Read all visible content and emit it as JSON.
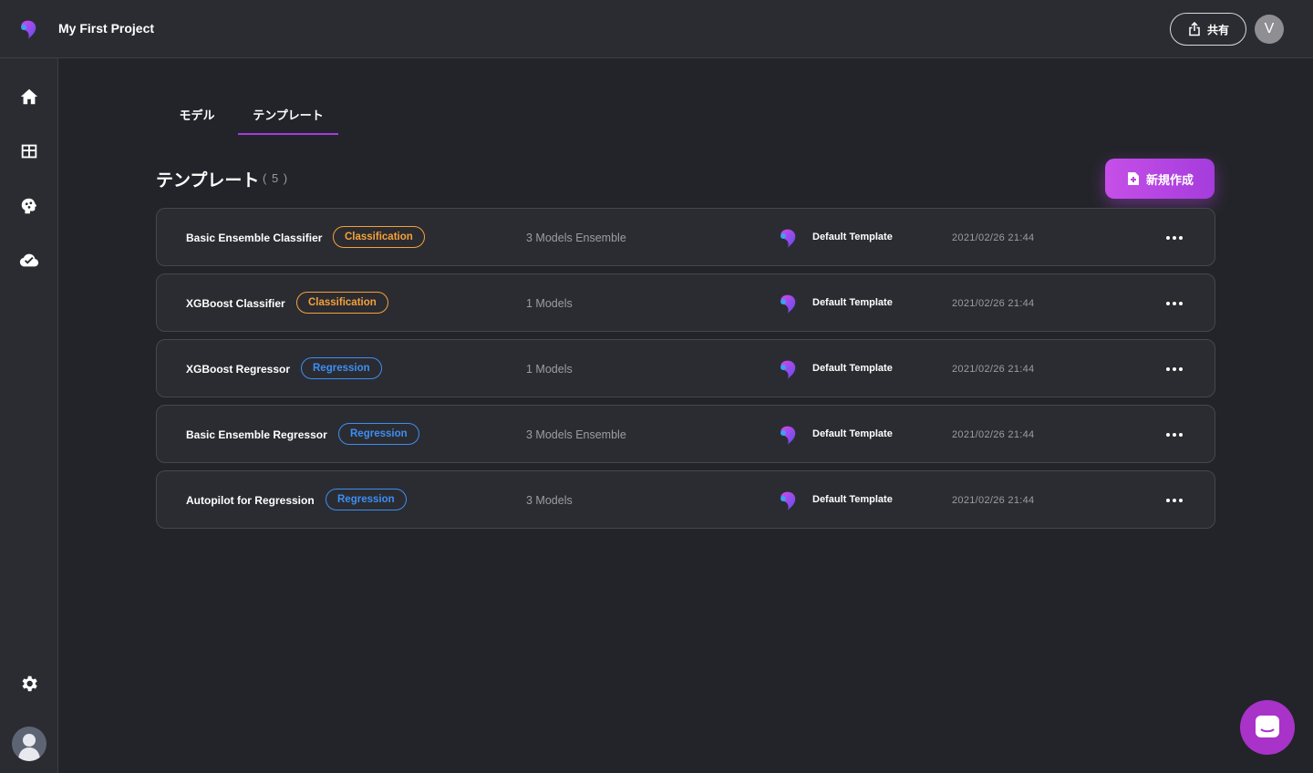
{
  "header": {
    "project_title": "My First Project",
    "share_label": "共有",
    "user_initial": "V"
  },
  "sidebar": {
    "items": [
      {
        "icon": "home-icon"
      },
      {
        "icon": "table-icon"
      },
      {
        "icon": "brain-icon"
      },
      {
        "icon": "cloud-check-icon"
      }
    ],
    "settings_icon": "gear-icon",
    "avatar_icon": "user-avatar"
  },
  "tabs": [
    {
      "label": "モデル",
      "active": false
    },
    {
      "label": "テンプレート",
      "active": true
    }
  ],
  "section": {
    "title": "テンプレート",
    "count": "( 5 )",
    "new_button_label": "新規作成"
  },
  "templates": [
    {
      "name": "Basic Ensemble Classifier",
      "badge": "Classification",
      "badge_type": "classification",
      "models": "3 Models Ensemble",
      "template": "Default Template",
      "date": "2021/02/26 21:44"
    },
    {
      "name": "XGBoost Classifier",
      "badge": "Classification",
      "badge_type": "classification",
      "models": "1 Models",
      "template": "Default Template",
      "date": "2021/02/26 21:44"
    },
    {
      "name": "XGBoost Regressor",
      "badge": "Regression",
      "badge_type": "regression",
      "models": "1 Models",
      "template": "Default Template",
      "date": "2021/02/26 21:44"
    },
    {
      "name": "Basic Ensemble Regressor",
      "badge": "Regression",
      "badge_type": "regression",
      "models": "3 Models Ensemble",
      "template": "Default Template",
      "date": "2021/02/26 21:44"
    },
    {
      "name": "Autopilot for Regression",
      "badge": "Regression",
      "badge_type": "regression",
      "models": "3 Models",
      "template": "Default Template",
      "date": "2021/02/26 21:44"
    }
  ],
  "colors": {
    "background": "#232429",
    "panel": "#2b2c31",
    "accent": "#a33de0",
    "classification": "#f5a13a",
    "regression": "#3c8ef5"
  }
}
